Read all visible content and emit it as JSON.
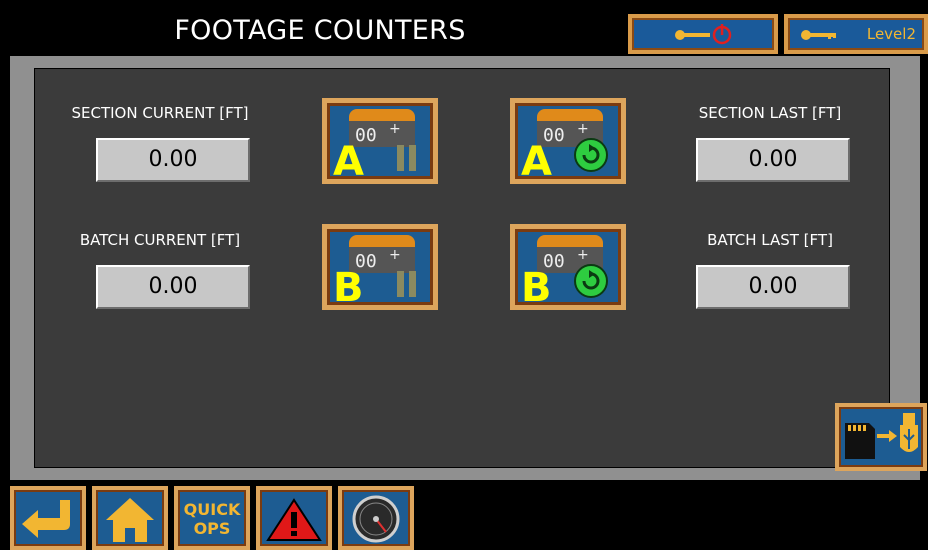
{
  "header": {
    "title": "FOOTAGE COUNTERS",
    "logout_icon": "key-power-icon",
    "level_icon": "key-icon",
    "level_label": "Level2"
  },
  "counters": {
    "section_current": {
      "label": "SECTION CURRENT [FT]",
      "value": "0.00"
    },
    "section_last": {
      "label": "SECTION LAST [FT]",
      "value": "0.00"
    },
    "batch_current": {
      "label": "BATCH CURRENT [FT]",
      "value": "0.00"
    },
    "batch_last": {
      "label": "BATCH LAST [FT]",
      "value": "0.00"
    }
  },
  "counter_buttons": {
    "a_pause": {
      "letter": "A",
      "digits": "00",
      "icon": "pause-icon"
    },
    "a_reset": {
      "letter": "A",
      "digits": "00",
      "icon": "reset-icon"
    },
    "b_pause": {
      "letter": "B",
      "digits": "00",
      "icon": "pause-icon"
    },
    "b_reset": {
      "letter": "B",
      "digits": "00",
      "icon": "reset-icon"
    }
  },
  "sd_to_usb_icon": "sd-to-usb-icon",
  "footer": {
    "back_icon": "back-arrow-icon",
    "home_icon": "home-icon",
    "quick_ops_line1": "QUICK",
    "quick_ops_line2": "OPS",
    "alarm_icon": "warning-icon",
    "gauge_icon": "gauge-icon"
  },
  "colors": {
    "button_blue": "#1d5c92",
    "button_border": "#dda55c",
    "accent_orange": "#f2b632",
    "letter_yellow": "#ffff00",
    "reset_green": "#2ecc40",
    "panel_dark": "#3b3b3b"
  }
}
